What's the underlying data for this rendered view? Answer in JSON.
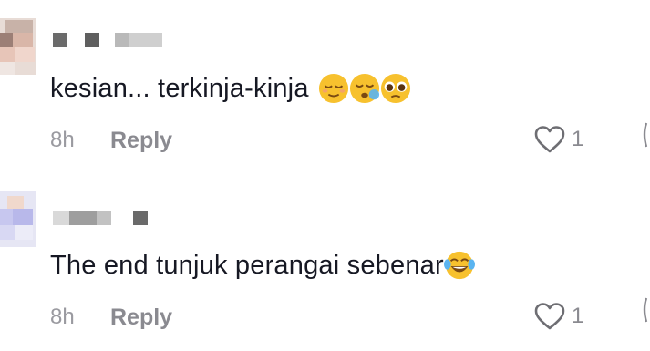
{
  "comments": [
    {
      "text": "kesian... terkinja-kinja",
      "emojis": [
        "relieved-face-emoji",
        "sleepy-face-emoji",
        "pleading-face-emoji"
      ],
      "time": "8h",
      "reply_label": "Reply",
      "like_count": "1",
      "username_redacted": true
    },
    {
      "text": "The end tunjuk perangai sebenar",
      "emojis": [
        "tears-of-joy-emoji"
      ],
      "time": "8h",
      "reply_label": "Reply",
      "like_count": "1",
      "username_redacted": true
    }
  ],
  "colors": {
    "text": "#161823",
    "muted": "#8a8a90",
    "emoji_yellow": "#f7c12e",
    "tear_blue": "#5ab4f0"
  }
}
